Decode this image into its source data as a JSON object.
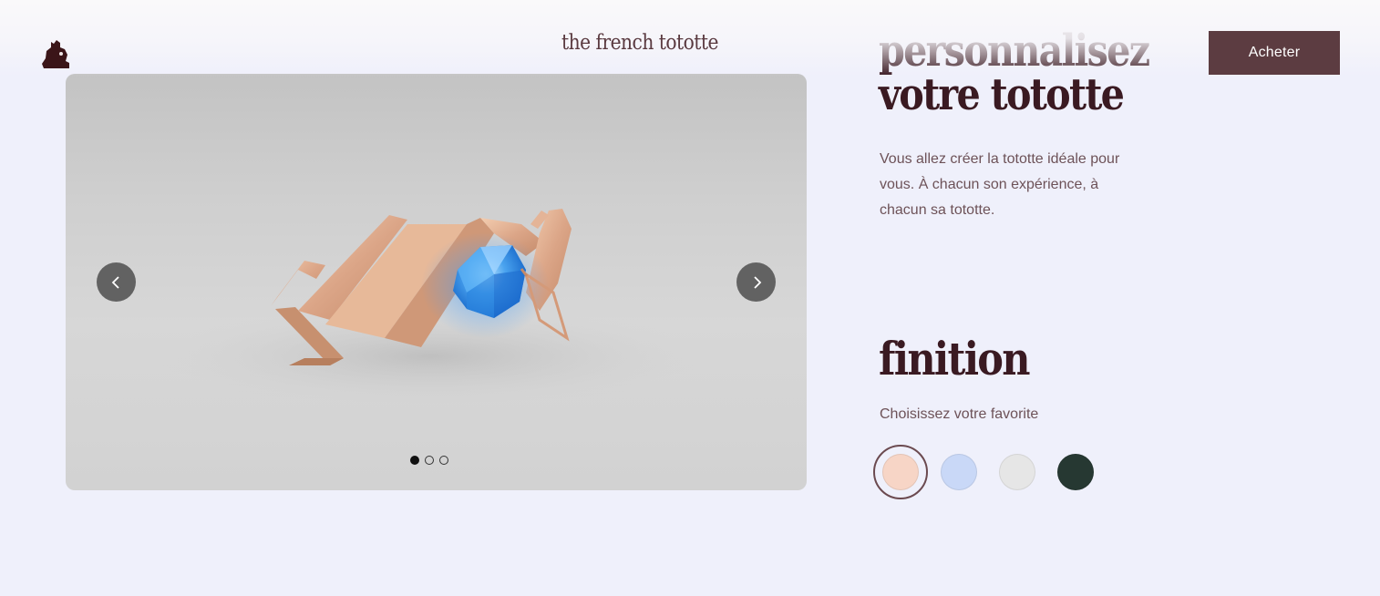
{
  "header": {
    "brand": "the french tototte",
    "buy_label": "Acheter"
  },
  "carousel": {
    "prev_icon": "chevron-left-icon",
    "next_icon": "chevron-right-icon",
    "slide_count": 3,
    "active_slide": 1
  },
  "customizer": {
    "title_line1": "personnalisez",
    "title_line2": "votre tototte",
    "intro": "Vous allez créer la tototte idéale pour vous. À chacun son expérience, à chacun sa tototte.",
    "finish_title": "finition",
    "finish_subtitle": "Choisissez votre favorite",
    "swatches": [
      {
        "name": "rose-gold",
        "color": "#f7d5c6",
        "selected": true
      },
      {
        "name": "light-blue",
        "color": "#c9d8f7",
        "selected": false
      },
      {
        "name": "silver",
        "color": "#e6e6e6",
        "selected": false
      },
      {
        "name": "dark-green",
        "color": "#263832",
        "selected": false
      }
    ]
  },
  "colors": {
    "accent": "#5c3c41",
    "background": "#eff0fb",
    "heading": "#3a1a22"
  }
}
